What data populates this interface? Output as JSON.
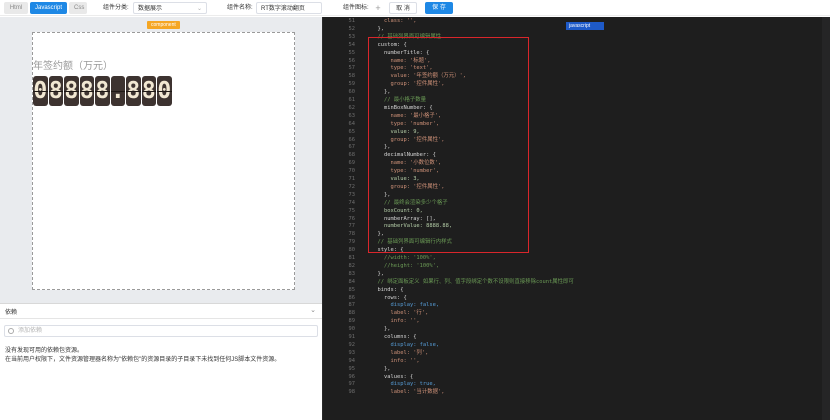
{
  "toolbar": {
    "tabs": [
      "Html",
      "Javascript",
      "Css"
    ],
    "category_label": "组件分类:",
    "category_value": "数据展示",
    "name_label": "组件名称:",
    "name_value": "RT数字滚动翻页",
    "icon_label": "组件图标:",
    "cancel_label": "取 消",
    "save_label": "保 存"
  },
  "preview": {
    "component_tag": "component",
    "number_title": "年签约额（万元）",
    "digits": [
      "0",
      "8",
      "8",
      "8",
      "8",
      ".",
      "8",
      "8",
      "0"
    ]
  },
  "dependency": {
    "title": "依赖",
    "search_placeholder": "添加依赖",
    "message_1": "没有发现可用的依赖包资源。",
    "message_2": "在当前用户权限下，文件资源管理器名称为\"依赖包\"的资源目录的子目录下未找到任何JS脚本文件资源。"
  },
  "editor": {
    "language": "javascript",
    "line_start": 51,
    "lines": [
      {
        "c": "c-str",
        "t": "    class: '',"
      },
      {
        "c": "c-plain",
        "t": "  },"
      },
      {
        "c": "c-comment",
        "t": "  // 基础列界面可编辑属性"
      },
      {
        "c": "c-key",
        "t": "  custom: {"
      },
      {
        "c": "c-key",
        "t": "    numberTitle: {"
      },
      {
        "c": "c-str",
        "t": "      name: '标题',"
      },
      {
        "c": "c-str",
        "t": "      type: 'text',"
      },
      {
        "c": "c-str",
        "t": "      value: '年签约额（万元）',"
      },
      {
        "c": "c-str",
        "t": "      group: '控件属性',"
      },
      {
        "c": "c-plain",
        "t": "    },"
      },
      {
        "c": "c-comment",
        "t": "    // 最小格子数量"
      },
      {
        "c": "c-key",
        "t": "    minBoxNumber: {"
      },
      {
        "c": "c-str",
        "t": "      name: '最小格子',"
      },
      {
        "c": "c-str",
        "t": "      type: 'number',"
      },
      {
        "c": "c-num",
        "t": "      value: 9,"
      },
      {
        "c": "c-str",
        "t": "      group: '控件属性',"
      },
      {
        "c": "c-plain",
        "t": "    },"
      },
      {
        "c": "c-key",
        "t": "    decimalNumber: {"
      },
      {
        "c": "c-str",
        "t": "      name: '小数位数',"
      },
      {
        "c": "c-str",
        "t": "      type: 'number',"
      },
      {
        "c": "c-num",
        "t": "      value: 3,"
      },
      {
        "c": "c-str",
        "t": "      group: '控件属性',"
      },
      {
        "c": "c-plain",
        "t": "    },"
      },
      {
        "c": "c-comment",
        "t": "    // 最终会渲染多少个格子"
      },
      {
        "c": "c-num",
        "t": "    boxCount: 0,"
      },
      {
        "c": "c-plain",
        "t": "    numberArray: [],"
      },
      {
        "c": "c-num",
        "t": "    numberValue: 8888.88,"
      },
      {
        "c": "c-plain",
        "t": "  },"
      },
      {
        "c": "c-comment",
        "t": "  // 基础列界面可编辑行内样式"
      },
      {
        "c": "c-key",
        "t": "  style: {"
      },
      {
        "c": "c-comment",
        "t": "    //width: '100%',"
      },
      {
        "c": "c-comment",
        "t": "    //height: '100%',"
      },
      {
        "c": "c-plain",
        "t": "  },"
      },
      {
        "c": "c-comment",
        "t": "  // 绑定面板定义 如果行、列、值字段绑定个数不设限则直接移除count属性即可"
      },
      {
        "c": "c-key",
        "t": "  binds: {"
      },
      {
        "c": "c-key",
        "t": "    rows: {"
      },
      {
        "c": "c-bool",
        "t": "      display: false,"
      },
      {
        "c": "c-str",
        "t": "      label: '行',"
      },
      {
        "c": "c-str",
        "t": "      info: '',"
      },
      {
        "c": "c-plain",
        "t": "    },"
      },
      {
        "c": "c-key",
        "t": "    columns: {"
      },
      {
        "c": "c-bool",
        "t": "      display: false,"
      },
      {
        "c": "c-str",
        "t": "      label: '列',"
      },
      {
        "c": "c-str",
        "t": "      info: '',"
      },
      {
        "c": "c-plain",
        "t": "    },"
      },
      {
        "c": "c-key",
        "t": "    values: {"
      },
      {
        "c": "c-bool",
        "t": "      display: true,"
      },
      {
        "c": "c-str",
        "t": "      label: '当计数据',"
      }
    ]
  }
}
